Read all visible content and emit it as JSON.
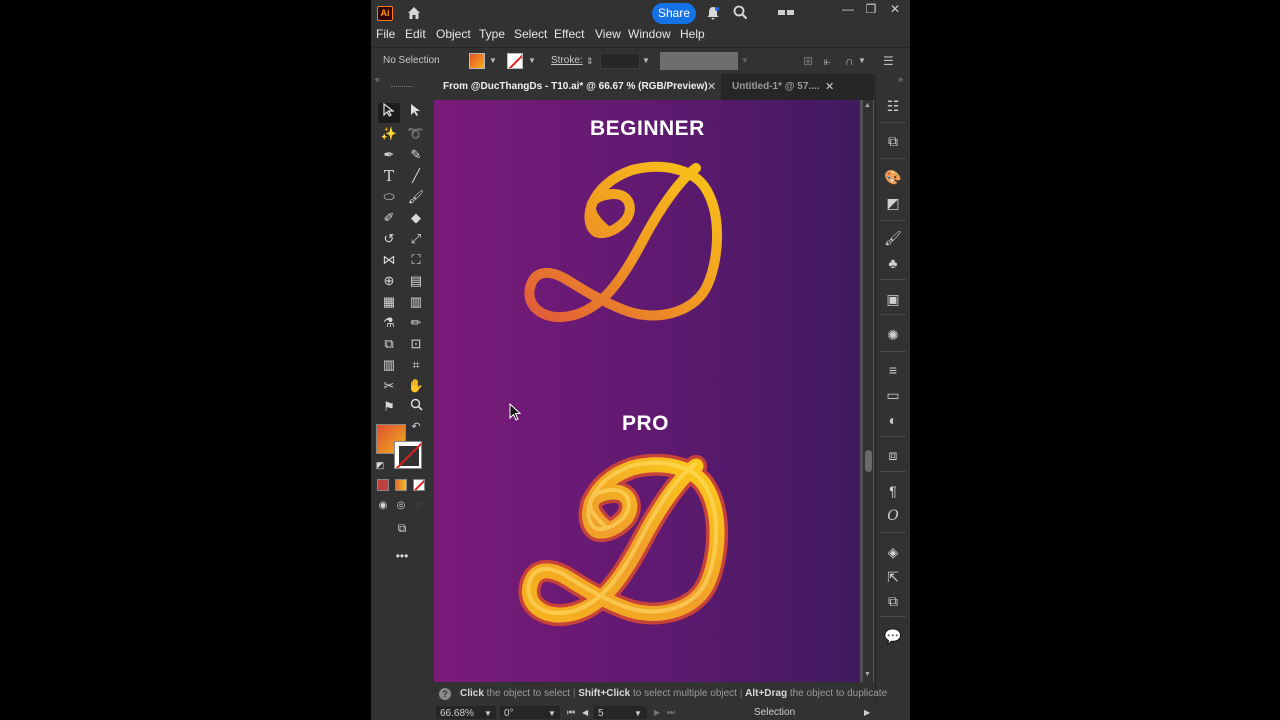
{
  "app": {
    "logo": "Ai",
    "share_label": "Share",
    "window_controls": [
      "—",
      "❐",
      "✕"
    ]
  },
  "menu": [
    "File",
    "Edit",
    "Object",
    "Type",
    "Select",
    "Effect",
    "View",
    "Window",
    "Help"
  ],
  "control_bar": {
    "selection": "No Selection",
    "stroke_label": "Stroke:"
  },
  "tabs": [
    {
      "label": "From @DucThangDs - T10.ai* @ 66.67 % (RGB/Preview)",
      "active": true
    },
    {
      "label": "Untitled-1* @ 57....",
      "active": false
    }
  ],
  "artboard": {
    "top_label": "BEGINNER",
    "bottom_label": "PRO",
    "gradient": {
      "start": "#e8542a",
      "end": "#f5b01a"
    },
    "background": {
      "left": "#7a1b7a",
      "right": "#3f1a5e"
    }
  },
  "hint": {
    "part1_bold": "Click",
    "part1": " the object to select",
    "part2_bold": "Shift+Click",
    "part2": " to select multiple object",
    "part3_bold": "Alt+Drag",
    "part3": " the object to duplicate"
  },
  "status": {
    "zoom": "66.68%",
    "rotation": "0°",
    "artboard_num": "5",
    "tool": "Selection"
  },
  "colors": {
    "accent": "#1473e6",
    "ui_bg": "#323232",
    "panel_dark": "#262626"
  }
}
